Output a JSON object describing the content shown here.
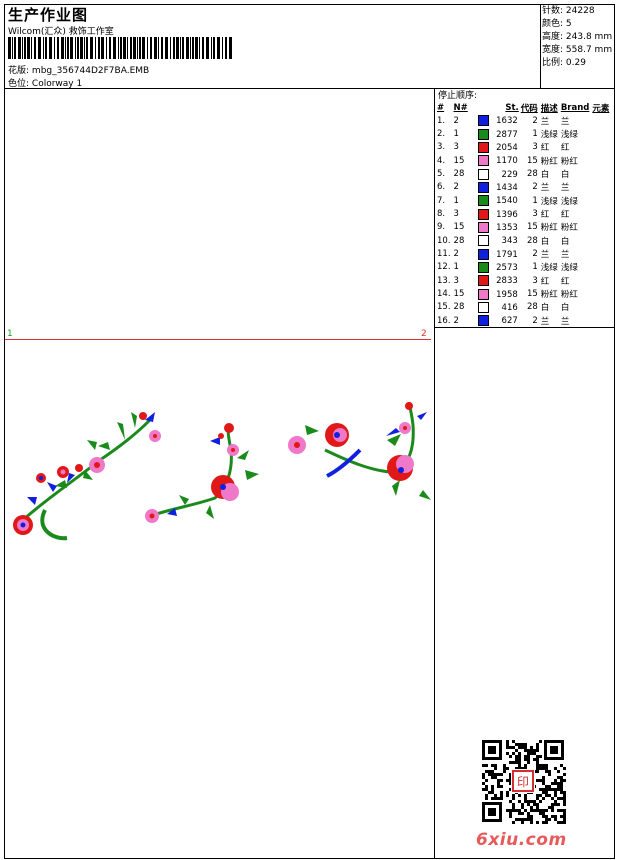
{
  "header": {
    "title": "生产作业图",
    "subtitle": "Wilcom(汇众) 救饰工作室",
    "design_label": "花版:",
    "design_value": "mbg_356744D2F7BA.EMB",
    "colorway_label": "色位:",
    "colorway_value": "Colorway 1"
  },
  "stats": [
    {
      "label": "针数:",
      "value": "24228"
    },
    {
      "label": "颜色:",
      "value": "5"
    },
    {
      "label": "高度:",
      "value": "243.8 mm"
    },
    {
      "label": "宽度:",
      "value": "558.7 mm"
    },
    {
      "label": "比例:",
      "value": "0.29"
    }
  ],
  "stop_sequence": {
    "title": "停止顺序:",
    "columns": [
      "#",
      "N#",
      "St.",
      "代码",
      "描述",
      "Brand",
      "元素"
    ],
    "rows": [
      {
        "idx": "1.",
        "n": "2",
        "color": "#1020e0",
        "st": "1632",
        "code": "2",
        "desc": "兰",
        "brand": "兰"
      },
      {
        "idx": "2.",
        "n": "1",
        "color": "#1a8a1a",
        "st": "2877",
        "code": "1",
        "desc": "浅绿",
        "brand": "浅绿"
      },
      {
        "idx": "3.",
        "n": "3",
        "color": "#e01818",
        "st": "2054",
        "code": "3",
        "desc": "红",
        "brand": "红"
      },
      {
        "idx": "4.",
        "n": "15",
        "color": "#f078c8",
        "st": "1170",
        "code": "15",
        "desc": "粉红",
        "brand": "粉红"
      },
      {
        "idx": "5.",
        "n": "28",
        "color": "#ffffff",
        "st": "229",
        "code": "28",
        "desc": "白",
        "brand": "白"
      },
      {
        "idx": "6.",
        "n": "2",
        "color": "#1020e0",
        "st": "1434",
        "code": "2",
        "desc": "兰",
        "brand": "兰"
      },
      {
        "idx": "7.",
        "n": "1",
        "color": "#1a8a1a",
        "st": "1540",
        "code": "1",
        "desc": "浅绿",
        "brand": "浅绿"
      },
      {
        "idx": "8.",
        "n": "3",
        "color": "#e01818",
        "st": "1396",
        "code": "3",
        "desc": "红",
        "brand": "红"
      },
      {
        "idx": "9.",
        "n": "15",
        "color": "#f078c8",
        "st": "1353",
        "code": "15",
        "desc": "粉红",
        "brand": "粉红"
      },
      {
        "idx": "10.",
        "n": "28",
        "color": "#ffffff",
        "st": "343",
        "code": "28",
        "desc": "白",
        "brand": "白"
      },
      {
        "idx": "11.",
        "n": "2",
        "color": "#1020e0",
        "st": "1791",
        "code": "2",
        "desc": "兰",
        "brand": "兰"
      },
      {
        "idx": "12.",
        "n": "1",
        "color": "#1a8a1a",
        "st": "2573",
        "code": "1",
        "desc": "浅绿",
        "brand": "浅绿"
      },
      {
        "idx": "13.",
        "n": "3",
        "color": "#e01818",
        "st": "2833",
        "code": "3",
        "desc": "红",
        "brand": "红"
      },
      {
        "idx": "14.",
        "n": "15",
        "color": "#f078c8",
        "st": "1958",
        "code": "15",
        "desc": "粉红",
        "brand": "粉红"
      },
      {
        "idx": "15.",
        "n": "28",
        "color": "#ffffff",
        "st": "416",
        "code": "28",
        "desc": "白",
        "brand": "白"
      },
      {
        "idx": "16.",
        "n": "2",
        "color": "#1020e0",
        "st": "627",
        "code": "2",
        "desc": "兰",
        "brand": "兰"
      }
    ]
  },
  "hoop": {
    "left_marker": "1",
    "right_marker": "2"
  },
  "watermark": "6xiu.com",
  "qr_stamp": "印"
}
